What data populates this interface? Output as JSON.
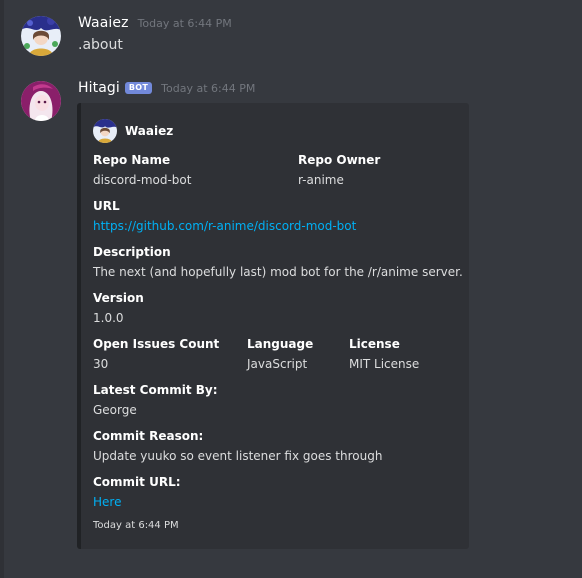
{
  "messages": [
    {
      "username": "Waaiez",
      "timestamp": "Today at 6:44 PM",
      "content": ".about"
    },
    {
      "username": "Hitagi",
      "bot_tag": "BOT",
      "timestamp": "Today at 6:44 PM"
    }
  ],
  "embed": {
    "author": "Waaiez",
    "fields": {
      "repo_name": {
        "name": "Repo Name",
        "value": "discord-mod-bot"
      },
      "repo_owner": {
        "name": "Repo Owner",
        "value": "r-anime"
      },
      "url": {
        "name": "URL",
        "value": "https://github.com/r-anime/discord-mod-bot"
      },
      "description": {
        "name": "Description",
        "value": "The next (and hopefully last) mod bot for the /r/anime server."
      },
      "version": {
        "name": "Version",
        "value": "1.0.0"
      },
      "open_issues": {
        "name": "Open Issues Count",
        "value": "30"
      },
      "language": {
        "name": "Language",
        "value": "JavaScript"
      },
      "license": {
        "name": "License",
        "value": "MIT License"
      },
      "latest_commit_by": {
        "name": "Latest Commit By:",
        "value": "George"
      },
      "commit_reason": {
        "name": "Commit Reason:",
        "value": "Update yuuko so event listener fix goes through"
      },
      "commit_url": {
        "name": "Commit URL:",
        "value": "Here"
      }
    },
    "footer": "Today at 6:44 PM"
  },
  "colors": {
    "background": "#36393f",
    "embed_background": "#2f3136",
    "bot_tag": "#7289da",
    "link": "#00b0f4",
    "timestamp": "#72767d"
  },
  "icons": {
    "waaiez_avatar": "anime-avatar-icon",
    "hitagi_avatar": "anime-avatar-icon"
  }
}
